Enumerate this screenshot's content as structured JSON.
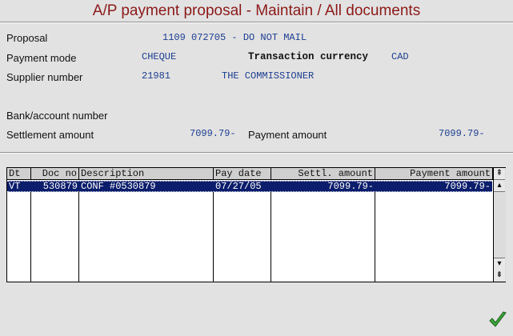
{
  "window": {
    "title": "A/P payment proposal - Maintain / All documents"
  },
  "form": {
    "proposal_label": "Proposal",
    "proposal_value": "1109 072705 - DO NOT MAIL",
    "payment_mode_label": "Payment mode",
    "payment_mode_value": "CHEQUE",
    "currency_label": "Transaction currency",
    "currency_value": "CAD",
    "supplier_label": "Supplier number",
    "supplier_number": "21981",
    "supplier_name": "THE COMMISSIONER",
    "bank_label": "Bank/account number",
    "settlement_label": "Settlement amount",
    "settlement_value": "7099.79-",
    "payment_label": "Payment amount",
    "payment_value": "7099.79-"
  },
  "table": {
    "columns": [
      "Dt",
      "Doc no",
      "Description",
      "Pay date",
      "Settl. amount",
      "Payment amount"
    ],
    "rows": [
      {
        "dt": "VT",
        "doc_no": "530879",
        "description": "CONF #0530879",
        "pay_date": "07/27/05",
        "settl_amount": "7099.79-",
        "payment_amount": "7099.79-"
      }
    ]
  },
  "icons": {
    "scroll_top": "double-up-arrow-icon",
    "scroll_up": "up-arrow-icon",
    "scroll_down": "down-arrow-icon",
    "scroll_bottom": "double-down-arrow-icon",
    "confirm": "checkmark-icon"
  },
  "colors": {
    "title": "#8b1a1a",
    "value": "#1c3d8f",
    "selected_row": "#0b1d6b",
    "confirm": "#2e8b2e"
  }
}
